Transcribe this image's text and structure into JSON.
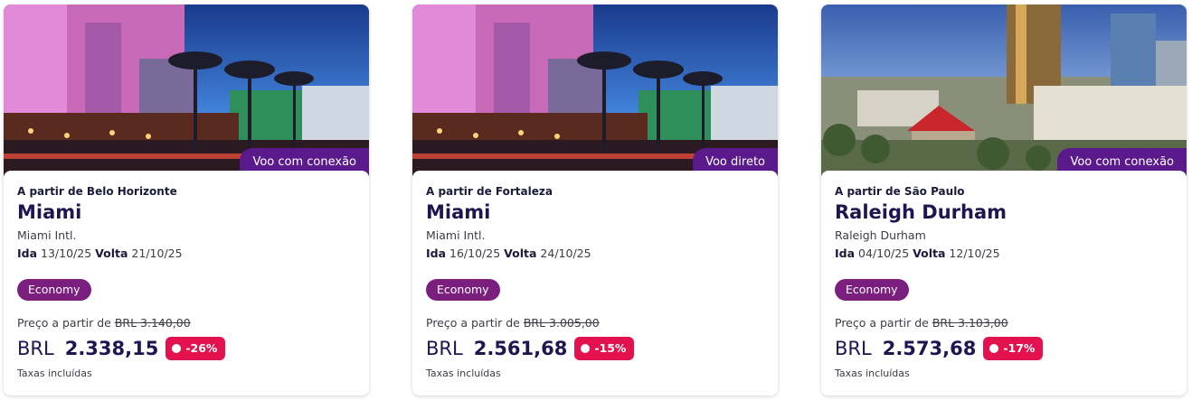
{
  "cards": [
    {
      "flight_type": "Voo com conexão",
      "origin": "A partir de Belo Horizonte",
      "destination": "Miami",
      "airport": "Miami Intl.",
      "outbound_label": "Ida",
      "outbound_date": "13/10/25",
      "return_label": "Volta",
      "return_date": "21/10/25",
      "cabin": "Economy",
      "price_from_label": "Preço a partir de",
      "old_price": "BRL  3.140,00",
      "currency": "BRL",
      "price": "2.338,15",
      "discount": "-26%",
      "taxes": "Taxas incluídas"
    },
    {
      "flight_type": "Voo direto",
      "origin": "A partir de Fortaleza",
      "destination": "Miami",
      "airport": "Miami Intl.",
      "outbound_label": "Ida",
      "outbound_date": "16/10/25",
      "return_label": "Volta",
      "return_date": "24/10/25",
      "cabin": "Economy",
      "price_from_label": "Preço a partir de",
      "old_price": "BRL  3.005,00",
      "currency": "BRL",
      "price": "2.561,68",
      "discount": "-15%",
      "taxes": "Taxas incluídas"
    },
    {
      "flight_type": "Voo com conexão",
      "origin": "A partir de São Paulo",
      "destination": "Raleigh Durham",
      "airport": "Raleigh Durham",
      "outbound_label": "Ida",
      "outbound_date": "04/10/25",
      "return_label": "Volta",
      "return_date": "12/10/25",
      "cabin": "Economy",
      "price_from_label": "Preço a partir de",
      "old_price": "BRL  3.103,00",
      "currency": "BRL",
      "price": "2.573,68",
      "discount": "-17%",
      "taxes": "Taxas incluídas"
    }
  ],
  "colors": {
    "brand_purple": "#5a1a8c",
    "cabin_purple": "#7b1f7f",
    "discount_red": "#e3124e",
    "title_navy": "#1d1651"
  }
}
